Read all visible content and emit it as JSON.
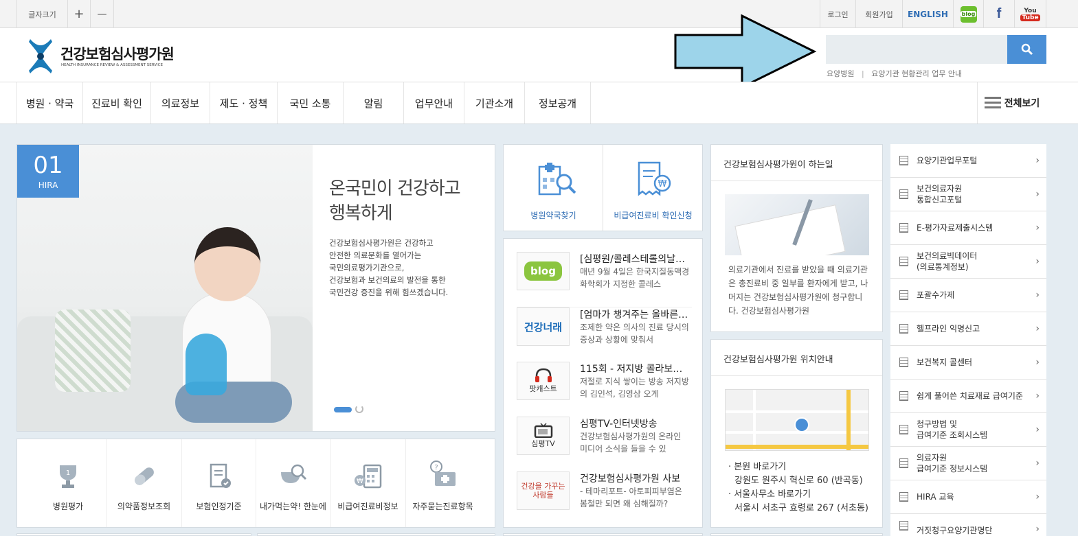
{
  "topbar": {
    "font_size": "글자크기",
    "plus": "+",
    "minus": "—",
    "login": "로그인",
    "join": "회원가입",
    "english": "ENGLISH",
    "blog": "blog",
    "facebook": "f",
    "youtube_top": "You",
    "youtube_bottom": "Tube"
  },
  "header": {
    "logo_kr": "건강보험심사평가원",
    "logo_en": "HEALTH INSURANCE REVIEW & ASSESSMENT SERVICE",
    "search_placeholder": "",
    "links": [
      "요양병원",
      "|",
      "요양기관 현황관리 업무 안내"
    ]
  },
  "nav": {
    "items": [
      "병원 · 약국",
      "진료비 확인",
      "의료정보",
      "제도 · 정책",
      "국민 소통",
      "알림",
      "업무안내",
      "기관소개",
      "정보공개"
    ],
    "all": "전체보기"
  },
  "banner": {
    "num": "01",
    "tag": "HIRA",
    "title1": "온국민이 건강하고",
    "title2": "행복하게",
    "body": [
      "건강보험심사평가원은 건강하고",
      "안전한 의료문화를 열어가는",
      "국민의료평가기관으로,",
      "건강보험과 보건의료의 발전을 통한",
      "국민건강 증진을 위해 힘쓰겠습니다."
    ]
  },
  "quick": [
    "병원평가",
    "의약품정보조회",
    "보험인정기준",
    "내가먹는약! 한눈에",
    "비급여진료비정보",
    "자주묻는진료항목"
  ],
  "cards": {
    "hospital": "병원약국찾기",
    "nonpay": "비급여진료비 확인신청"
  },
  "news": [
    {
      "thumb": "blog",
      "title": "[심평원/콜레스테롤의날…",
      "desc": "매년 9월 4일은 한국지질동맥경화학회가 지정한 콜레스"
    },
    {
      "thumb": "건강너래",
      "title": "[엄마가 챙겨주는 올바른…",
      "desc": "조제한 약은 의사의 진료 당시의 증상과 상황에 맞춰서"
    },
    {
      "thumb": "팟캐스트",
      "title": "115회 - 저지방 콜라보…",
      "desc": "저절로 지식 쌓이는 방송 저지방의 김인석, 김영삼 오게"
    },
    {
      "thumb": "심평TV",
      "title": "심평TV-인터넷방송",
      "desc": "건강보험심사평가원의 온라인 미디어 소식을 들을 수 있"
    },
    {
      "thumb": "건강을 가꾸는 사람들",
      "title": "건강보험심사평가원 사보",
      "desc": "- 테마리포트- 아토피피부염은 봄철만 되면 왜 심해질까?"
    }
  ],
  "role": {
    "title": "건강보험심사평가원이 하는일",
    "desc": "의료기관에서 진료를 받았을 때 의료기관은 총진료비 중 일부를 환자에게 받고, 나머지는 건강보험심사평가원에 청구합니다. 건강보험심사평가원"
  },
  "location": {
    "title": "건강보험심사평가원 위치안내",
    "hq_link": "본원 바로가기",
    "hq_addr": "강원도 원주시 혁신로 60 (반곡동)",
    "seoul_link": "서울사무소 바로가기",
    "seoul_addr": "서울시 서초구 효령로 267 (서초동)"
  },
  "side": [
    "요양기관업무포털",
    "보건의료자원\n통합신고포털",
    "E-평가자료제출시스템",
    "보건의료빅데이터\n(의료통계정보)",
    "포괄수가제",
    "헬프라인 익명신고",
    "보건복지 콜센터",
    "쉽게 풀어쓴 치료재료 급여기준",
    "청구방법 및\n급여기준 조회시스템",
    "의료자원\n급여기준 정보시스템",
    "HIRA 교육",
    "거짓청구요양기관명단"
  ],
  "colors": {
    "accent": "#4a8fd6",
    "arrow": "#9dd4ea",
    "english": "#2f6db4"
  }
}
